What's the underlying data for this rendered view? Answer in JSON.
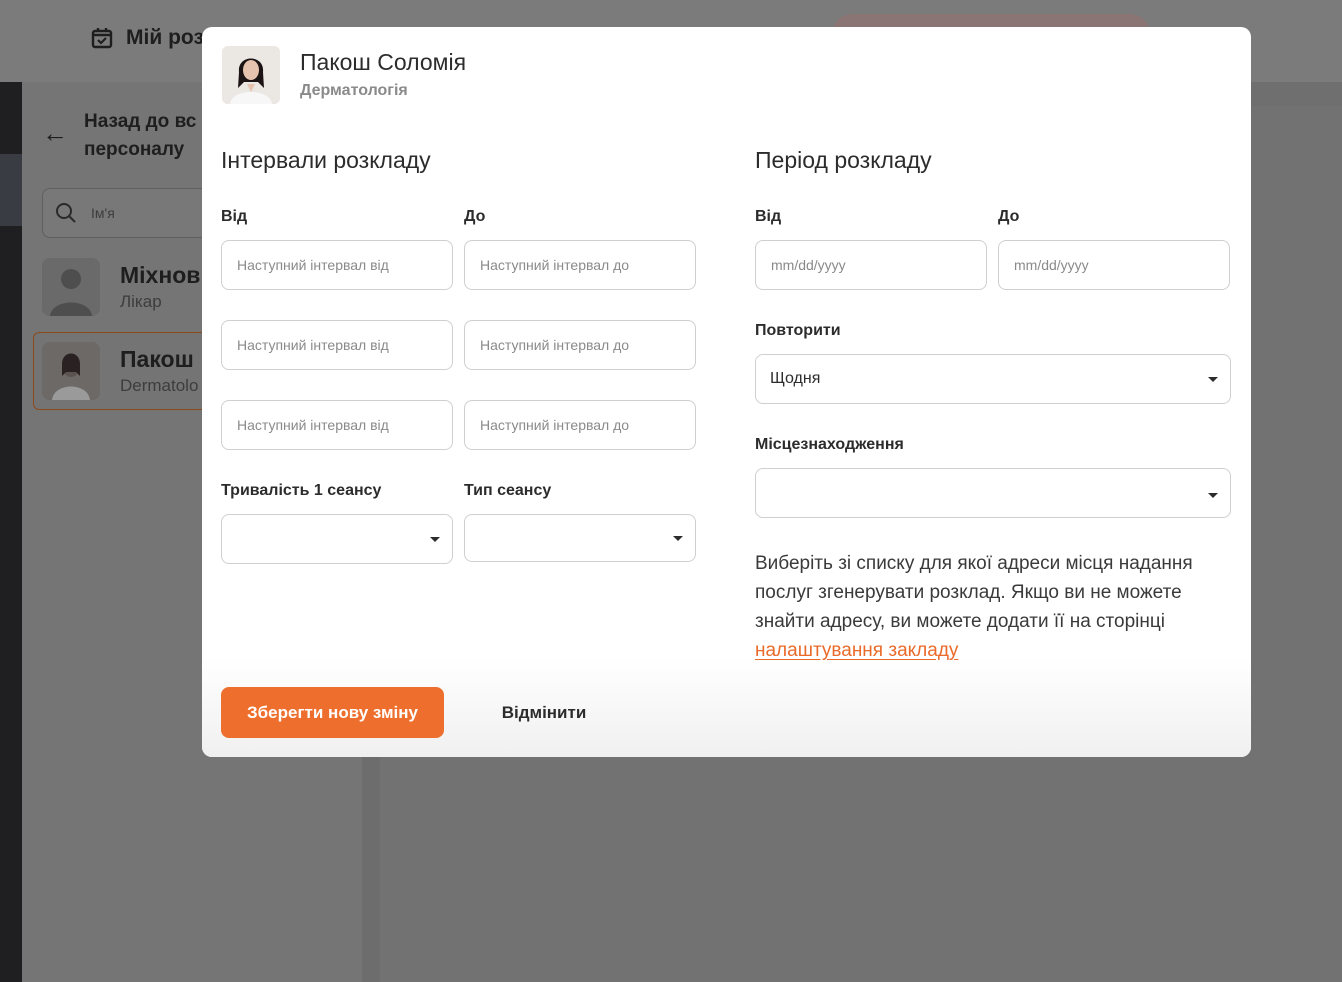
{
  "background": {
    "title": "Мій роз",
    "back_label": "Назад до вс персоналу",
    "search_placeholder": "Ім'я",
    "staff": [
      {
        "name": "Міхнов",
        "role": "Лікар"
      },
      {
        "name": "Пакош",
        "role": "Dermatolo"
      }
    ],
    "icons": [
      "calendar-check-icon",
      "arrow-left-icon",
      "search-icon"
    ]
  },
  "modal": {
    "doctor": {
      "name": "Пакош Соломія",
      "specialty": "Дерматологія"
    },
    "intervals": {
      "title": "Інтервали розкладу",
      "from_label": "Від",
      "to_label": "До",
      "rows": [
        {
          "from_placeholder": "Наступний інтервал від",
          "to_placeholder": "Наступний інтервал до"
        },
        {
          "from_placeholder": "Наступний інтервал від",
          "to_placeholder": "Наступний інтервал до"
        },
        {
          "from_placeholder": "Наступний інтервал від",
          "to_placeholder": "Наступний інтервал до"
        }
      ],
      "duration_label": "Тривалість 1 сеансу",
      "duration_value": "",
      "session_type_label": "Тип сеансу",
      "session_type_value": ""
    },
    "period": {
      "title": "Період розкладу",
      "from_label": "Від",
      "to_label": "До",
      "from_placeholder": "mm/dd/yyyy",
      "to_placeholder": "mm/dd/yyyy",
      "repeat_label": "Повторити",
      "repeat_value": "Щодня",
      "location_label": "Місцезнаходження",
      "location_value": "",
      "help_text": "Виберіть зі списку для якої адреси місця надання послуг згенерувати розклад. Якщо ви не можете знайти адресу, ви можете додати її на сторінці",
      "help_link": "налаштування закладу"
    },
    "buttons": {
      "save": "Зберегти нову зміну",
      "cancel": "Відмінити"
    }
  },
  "colors": {
    "accent": "#ee6f2d",
    "link": "#ea6a2a",
    "overlay": "#7b7b7b"
  }
}
